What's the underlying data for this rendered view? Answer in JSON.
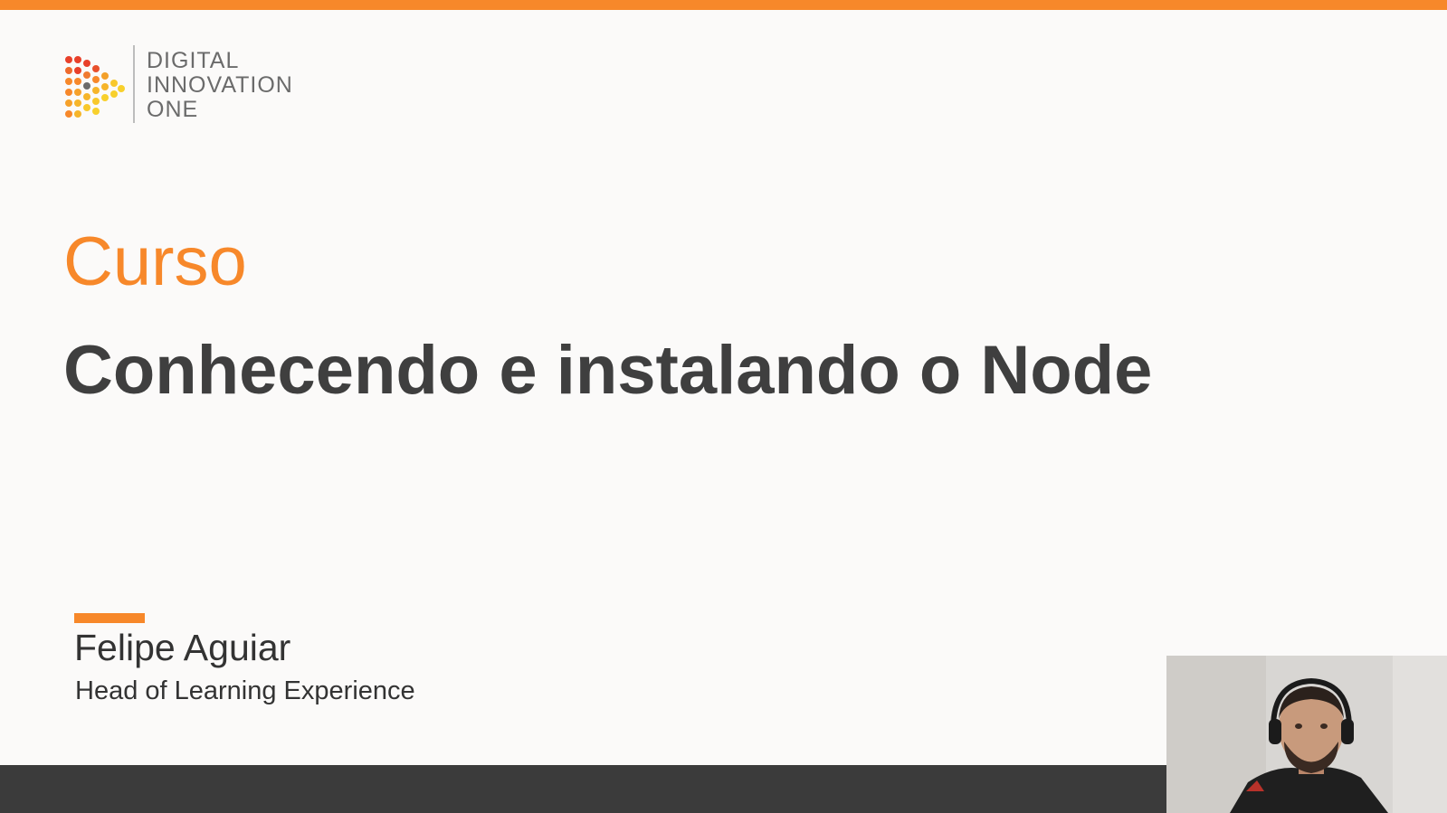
{
  "logo": {
    "lines": [
      "DIGITAL",
      "INNOVATION",
      "ONE"
    ]
  },
  "slide": {
    "label": "Curso",
    "title": "Conhecendo e instalando o Node"
  },
  "presenter": {
    "name": "Felipe Aguiar",
    "role": "Head of Learning Experience"
  },
  "colors": {
    "accent": "#f7882a",
    "title": "#3f3f3f",
    "bottom_bar": "#3b3b3b"
  },
  "icons": {
    "logo_mark": "dotted-triangle-logo-icon"
  }
}
